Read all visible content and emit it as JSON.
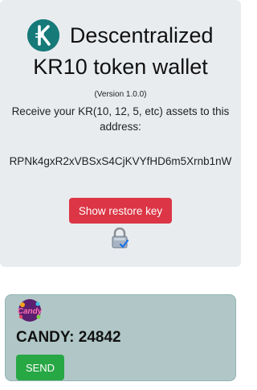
{
  "header": {
    "title_line1": "Descentralized",
    "title_line2": "KR10 token wallet",
    "version": "(Version 1.0.0)",
    "receive_text": "Receive your KR(10, 12, 5, etc) assets to this address:",
    "address": "RPNk4gxR2xVBSxS4CjKVYfHD6m5Xrnb1nW",
    "restore_button_label": "Show restore key",
    "logo_icon": "komodo-logo-icon",
    "lock_icon": "lock-icon"
  },
  "token": {
    "logo_text": "Candy",
    "balance_label": "CANDY: 24842",
    "send_button_label": "SEND"
  },
  "colors": {
    "card_bg": "#e9ecef",
    "logo_bg": "#167a79",
    "restore_button": "#dc3545",
    "token_card_bg": "#b1c7c7",
    "send_button": "#28a745"
  }
}
